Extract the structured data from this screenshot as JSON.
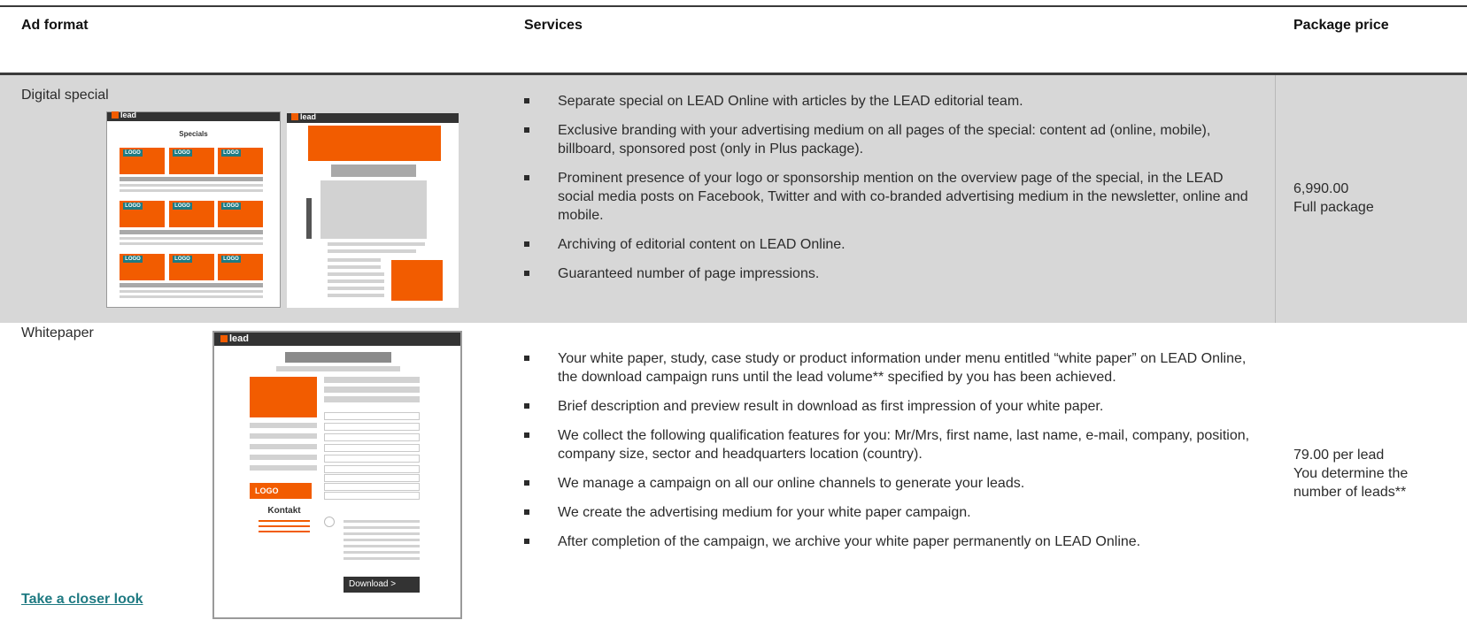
{
  "table": {
    "headers": {
      "ad_format": "Ad format",
      "services": "Services",
      "package_price": "Package price"
    },
    "rows": [
      {
        "format": "Digital special",
        "services": [
          "Separate special on LEAD Online with articles by the LEAD editorial team.",
          "Exclusive branding with your advertising medium on all pages of the special: content ad (online, mobile), billboard, sponsored post (only in Plus package).",
          "Prominent presence of your logo or sponsorship mention on the overview page of the special, in the LEAD social media posts on Facebook, Twitter and with co-branded advertising medium in the newsletter, online and mobile.",
          "Archiving of editorial content on LEAD Online.",
          "Guaranteed number of page impressions."
        ],
        "price_line1": "6,990.00",
        "price_line2": "Full package",
        "mockup": {
          "brand": "lead",
          "heading": "Specials",
          "logo_label": "LOGO"
        }
      },
      {
        "format": "Whitepaper",
        "link": "Take a closer look",
        "services": [
          "Your white paper, study, case study or product information under menu entitled “white paper” on LEAD Online, the download campaign runs until the lead volume**  specified by you has been achieved.",
          "Brief description and preview result in download as first impression of your white paper.",
          "We collect the following qualification features for you: Mr/Mrs, first name, last name, e-mail, company, position, company size, sector and headquarters location (country).",
          "We manage a campaign on all our online channels to generate your leads.",
          "We create the advertising medium for your white paper campaign.",
          "After completion of the campaign, we archive your white paper permanently on LEAD Online."
        ],
        "price_line1": "79.00 per lead",
        "price_line2": "You determine the",
        "price_line3": "number of leads**",
        "mockup": {
          "brand": "lead",
          "logo_label": "LOGO",
          "contact_label": "Kontakt",
          "download_label": "Download >"
        }
      }
    ]
  },
  "colors": {
    "accent_orange": "#f25c00",
    "teal": "#1f7a82",
    "row_grey": "#d7d7d7"
  }
}
